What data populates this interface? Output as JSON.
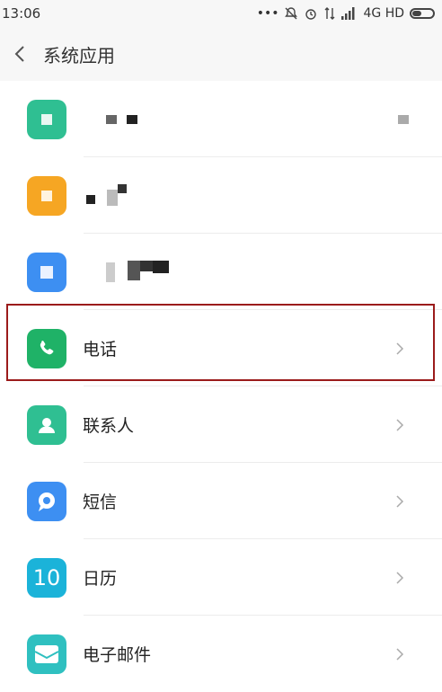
{
  "status_bar": {
    "time": "13:06",
    "network": "4G HD"
  },
  "header": {
    "title": "系统应用"
  },
  "apps": [
    {
      "label": "电话",
      "icon": "phone-icon",
      "color": "#1fb267"
    },
    {
      "label": "联系人",
      "icon": "contact-icon",
      "color": "#2fbf92"
    },
    {
      "label": "短信",
      "icon": "message-icon",
      "color": "#3d8ff2"
    },
    {
      "label": "日历",
      "icon": "calendar-icon",
      "color": "#1bb3d9",
      "icon_text": "10"
    },
    {
      "label": "电子邮件",
      "icon": "mail-icon",
      "color": "#2fc0c0"
    }
  ]
}
